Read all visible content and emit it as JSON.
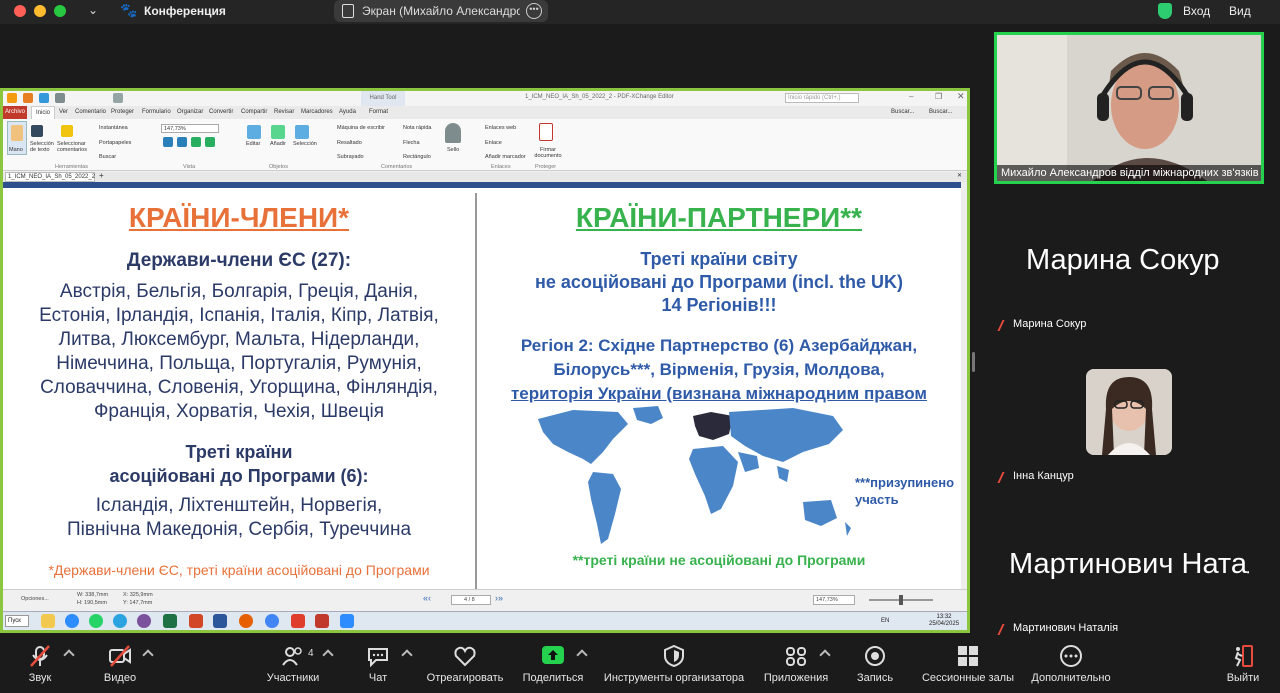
{
  "titlebar": {
    "title": "Конференция",
    "screen_label": "Экран (Михайло Александров)",
    "login": "Вход",
    "view": "Вид"
  },
  "xchange": {
    "caption": "1_ICM_NEO_IA_Sh_05_2022_2 - PDF-XChange Editor",
    "hand_tool": "Hand Tool",
    "search_placeholder": "Inicio rápido (Ctrl+.)",
    "tabs": [
      "Archivo",
      "Inicio",
      "Ver",
      "Comentario",
      "Proteger",
      "Formulario",
      "Organizar",
      "Convertir",
      "Compartir",
      "Revisar",
      "Marcadores",
      "Ayuda",
      "Format"
    ],
    "buscar": "Buscar...",
    "ribbon": {
      "mano": "Mano",
      "seleccion_texto": "Selección de texto",
      "seleccionar_comentarios": "Seleccionar comentarios",
      "instantanea": "Instantánea",
      "portapapeles": "Portapapeles",
      "buscar": "Buscar",
      "herramientas": "Herramientas",
      "zoom": "147,73%",
      "vista": "Vista",
      "editar": "Editar",
      "anadir": "Añadir",
      "seleccion": "Selección",
      "objetos": "Objetos",
      "maquina": "Máquina de escribir",
      "nota": "Nota rápida",
      "resaltado": "Resaltado",
      "flecha": "Flecha",
      "subrayado": "Subrayado",
      "rectangulo": "Rectángulo",
      "comentarios": "Comentarios",
      "sello": "Sello",
      "enlaces_web": "Enlaces web",
      "enlace": "Enlace",
      "anadir_marcador": "Añadir marcador",
      "enlaces": "Enlaces",
      "firmar": "Firmar documento",
      "proteger": "Proteger"
    },
    "doc_tab": "1_ICM_NEO_IA_Sh_05_2022_2",
    "status": {
      "opciones": "Opciones...",
      "w": "W: 338,7mm",
      "h": "H: 190,5mm",
      "x": "X: 325,9mm",
      "y": "Y: 147,7mm",
      "page": "4 / 8",
      "zoom": "147,73%"
    }
  },
  "slide": {
    "left_title": "КРАЇНИ-ЧЛЕНИ*",
    "right_title": "КРАЇНИ-ПАРТНЕРИ**",
    "left_heading": "Держави-члени ЄС (27):",
    "left_list": [
      "Австрія, Бельгія,  Болгарія, Греція, Данія,",
      "Естонія, Ірландія, Іспанія, Італія, Кіпр, Латвія,",
      "Литва, Люксембург, Мальта, Нідерланди,",
      "Німеччина, Польща, Португалія, Румунія,",
      "Словаччина, Словенія, Угорщина, Фінляндія,",
      "Франція, Хорватія, Чехія, Швеція"
    ],
    "left_third_heading": [
      "Треті країни",
      "асоційовані до Програми (6):"
    ],
    "left_third_list": [
      "Ісландія, Ліхтенштейн, Норвегія,",
      "Північна Македонія, Сербія, Туреччина"
    ],
    "left_footnote": "*Держави-члени ЄС, треті країни асоційовані до Програми",
    "right_intro": [
      "Треті країни світу",
      "не асоційовані до Програми (incl. the UK)",
      "14 Регіонів!!!"
    ],
    "right_region_line1": "Регіон 2: Східне Партнерство (6) Азербайджан,",
    "right_region_line2": "Білорусь***, Вірменія, Грузія, Молдова,",
    "right_region_line3": "територія України (визнана міжнародним правом",
    "right_suspended": [
      "***призупинено",
      "участь"
    ],
    "right_footnote": "**треті країни не асоційовані до Програми"
  },
  "taskbar": {
    "start": "Пуск",
    "lang": "EN",
    "time": "13:32",
    "date": "25/04/2025"
  },
  "participants": {
    "main_name": "Михайло Александров відділ міжнародних зв'язків",
    "sokur_big": "Марина Сокур",
    "sokur_small": "Марина Сокур",
    "kancur_small": "Інна Канцур",
    "mart_big": "Мартинович Наталія",
    "mart_small": "Мартинович Наталія"
  },
  "toolbar": {
    "sound": "Звук",
    "video": "Видео",
    "participants": "Участники",
    "participants_count": "4",
    "chat": "Чат",
    "react": "Отреагировать",
    "share": "Поделиться",
    "host_tools": "Инструменты организатора",
    "apps": "Приложения",
    "record": "Запись",
    "rooms": "Сессионные залы",
    "more": "Дополнительно",
    "leave": "Выйти"
  },
  "colors": {
    "share_border": "#8cc63f",
    "speaker_border": "#24d24e",
    "slide_orange": "#e8713a",
    "slide_green": "#37b24d",
    "slide_blue": "#2e5aa8",
    "slide_navy": "#2b3a67",
    "share_button": "#24d24e"
  }
}
